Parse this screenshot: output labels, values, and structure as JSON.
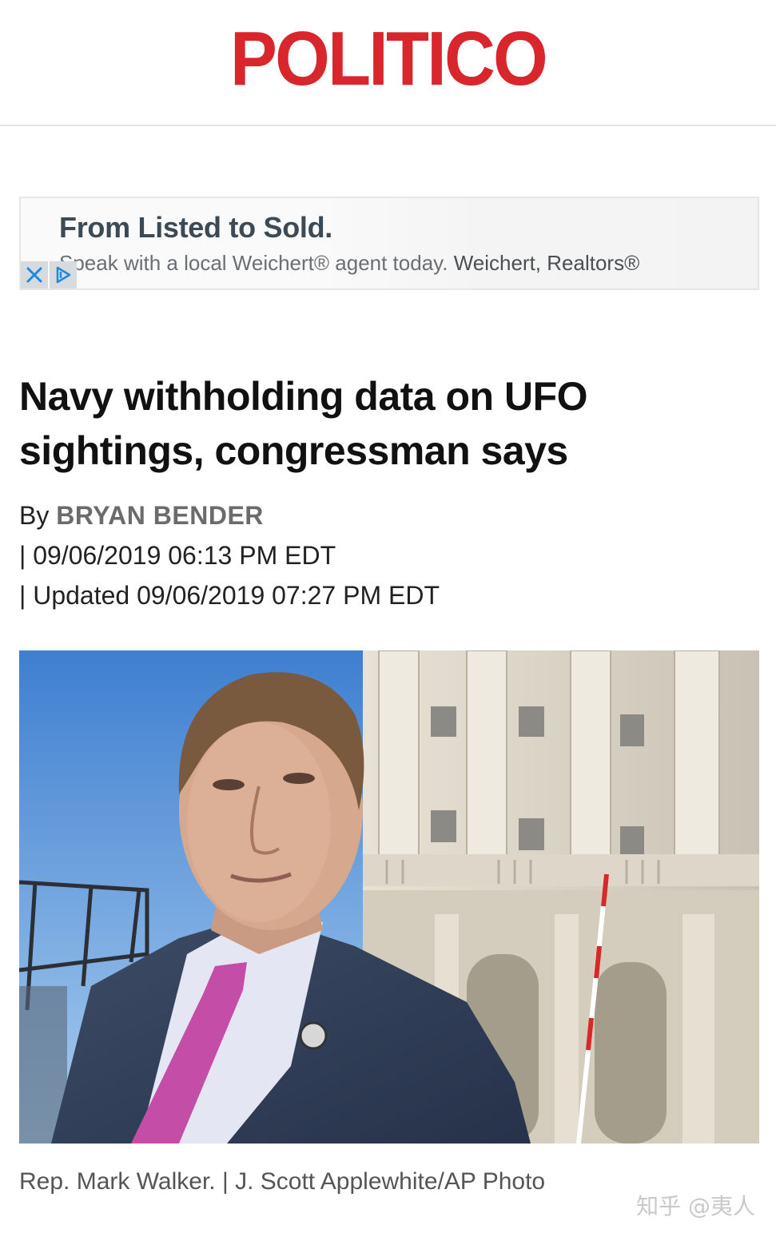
{
  "masthead": {
    "logo_text": "POLITICO",
    "brand_color": "#d8262c"
  },
  "ad": {
    "headline": "From Listed to Sold.",
    "body": "Speak with a local Weichert® agent today.",
    "advertiser": "Weichert, Realtors®",
    "close_icon": "close-icon",
    "adchoices_icon": "adchoices-icon"
  },
  "article": {
    "headline_line1": "Navy withholding data on UFO",
    "headline_line2": "sightings, congressman says",
    "by_label": "By",
    "author": "BRYAN BENDER",
    "published": "| 09/06/2019 06:13 PM EDT",
    "updated": "| Updated 09/06/2019 07:27 PM EDT",
    "photo_caption": "Rep. Mark Walker. | J. Scott Applewhite/AP Photo"
  },
  "watermark": {
    "text": "知乎 @夷人"
  }
}
